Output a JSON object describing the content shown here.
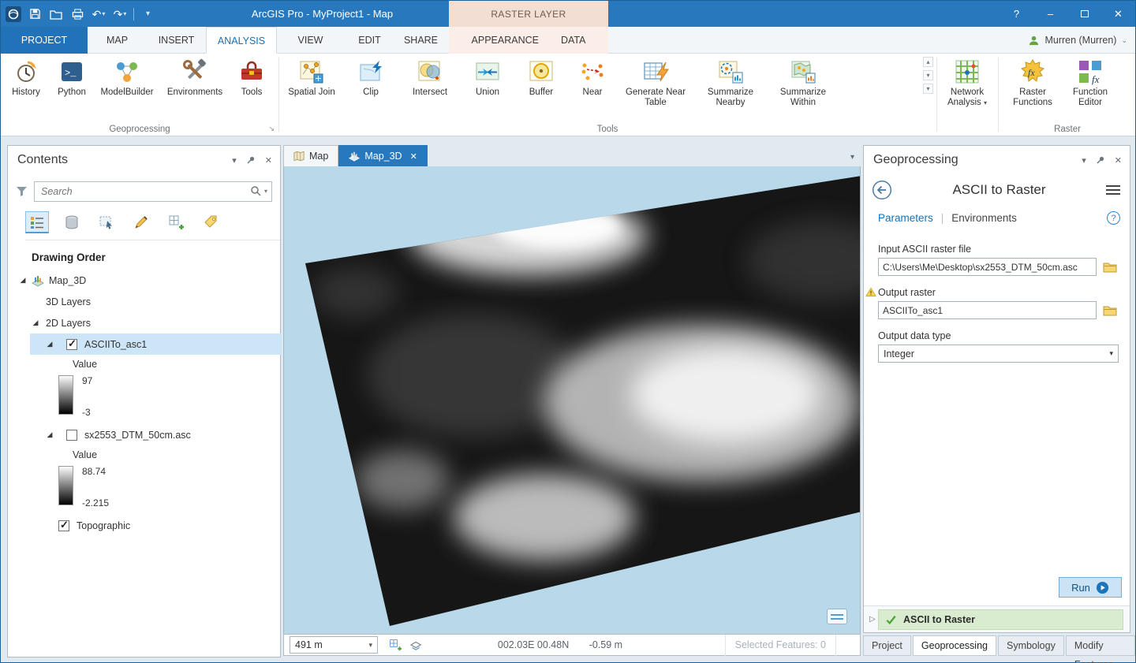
{
  "titlebar": {
    "title": "ArcGIS Pro - MyProject1 - Map",
    "contextual_group": "RASTER LAYER"
  },
  "tabs": {
    "project": "PROJECT",
    "map": "MAP",
    "insert": "INSERT",
    "analysis": "ANALYSIS",
    "view": "VIEW",
    "edit": "EDIT",
    "share": "SHARE",
    "appearance": "APPEARANCE",
    "data": "DATA"
  },
  "user": {
    "name": "Murren (Murren)"
  },
  "ribbon": {
    "geoprocessing": {
      "label": "Geoprocessing",
      "items": [
        "History",
        "Python",
        "ModelBuilder",
        "Environments",
        "Tools"
      ]
    },
    "tools": {
      "label": "Tools",
      "items": [
        "Spatial Join",
        "Clip",
        "Intersect",
        "Union",
        "Buffer",
        "Near",
        "Generate Near Table",
        "Summarize Nearby",
        "Summarize Within"
      ]
    },
    "network": {
      "label": "Network Analysis"
    },
    "raster": {
      "label": "Raster",
      "items": [
        "Raster Functions",
        "Function Editor"
      ]
    }
  },
  "contents": {
    "title": "Contents",
    "search_placeholder": "Search",
    "drawing_order": "Drawing Order",
    "tree": {
      "scene": "Map_3D",
      "group_3d": "3D Layers",
      "group_2d": "2D Layers",
      "layer1": {
        "name": "ASCIITo_asc1",
        "checked": true,
        "selected": true,
        "legend": "Value",
        "max": "97",
        "min": "-3"
      },
      "layer2": {
        "name": "sx2553_DTM_50cm.asc",
        "checked": false,
        "legend": "Value",
        "max": "88.74",
        "min": "-2.215"
      },
      "layer3": {
        "name": "Topographic",
        "checked": true
      }
    }
  },
  "mapview": {
    "tab_map": "Map",
    "tab_map3d": "Map_3D",
    "scale": "491 m",
    "coordinates": "002.03E 00.48N",
    "elevation": "-0.59 m",
    "selected_features": "Selected Features: 0"
  },
  "geoprocessing_pane": {
    "title": "Geoprocessing",
    "tool_title": "ASCII to Raster",
    "tab_parameters": "Parameters",
    "tab_environments": "Environments",
    "help": "?",
    "fields": {
      "input_label": "Input ASCII raster file",
      "input_value": "C:\\Users\\Me\\Desktop\\sx2553_DTM_50cm.asc",
      "output_label": "Output raster",
      "output_value": "ASCIITo_asc1",
      "datatype_label": "Output data type",
      "datatype_value": "Integer"
    },
    "run_label": "Run",
    "result_item": "ASCII to Raster",
    "bottom_tabs": [
      "Project",
      "Geoprocessing",
      "Symbology",
      "Modify Features"
    ]
  }
}
